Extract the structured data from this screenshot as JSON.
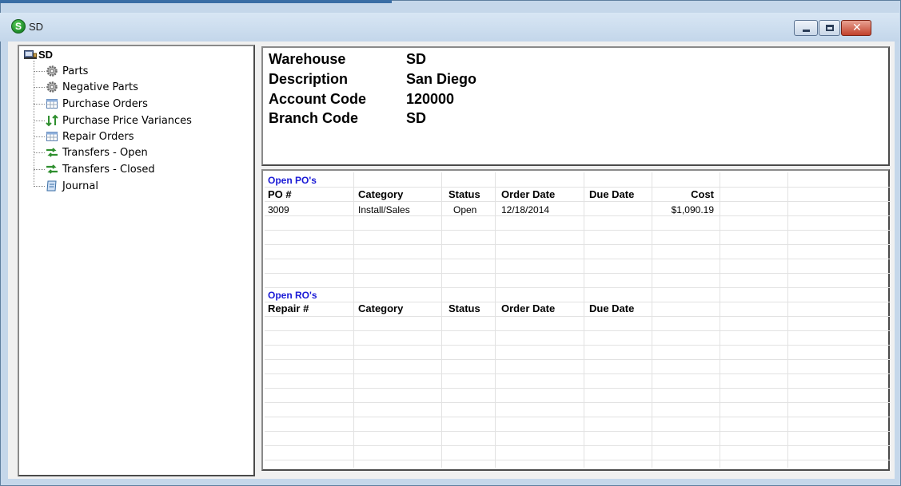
{
  "window": {
    "title": "SD",
    "app_icon_letter": "S"
  },
  "tree": {
    "root_label": "SD",
    "items": [
      {
        "label": "Parts",
        "icon": "gear-icon"
      },
      {
        "label": "Negative Parts",
        "icon": "gear-icon"
      },
      {
        "label": "Purchase Orders",
        "icon": "table-icon"
      },
      {
        "label": "Purchase Price Variances",
        "icon": "up-down-arrows-icon"
      },
      {
        "label": "Repair Orders",
        "icon": "table-icon"
      },
      {
        "label": "Transfers - Open",
        "icon": "transfer-icon"
      },
      {
        "label": "Transfers - Closed",
        "icon": "transfer-icon"
      },
      {
        "label": "Journal",
        "icon": "journal-icon"
      }
    ]
  },
  "info": {
    "warehouse_label": "Warehouse",
    "warehouse_value": "SD",
    "description_label": "Description",
    "description_value": "San Diego",
    "account_code_label": "Account Code",
    "account_code_value": "120000",
    "branch_code_label": "Branch Code",
    "branch_code_value": "SD"
  },
  "open_pos": {
    "section_title": "Open PO's",
    "headers": [
      "PO #",
      "Category",
      "Status",
      "Order Date",
      "Due Date",
      "Cost"
    ],
    "rows": [
      [
        "3009",
        "Install/Sales",
        "Open",
        "12/18/2014",
        "",
        "$1,090.19"
      ]
    ]
  },
  "open_ros": {
    "section_title": "Open RO's",
    "headers": [
      "Repair #",
      "Category",
      "Status",
      "Order Date",
      "Due Date"
    ],
    "rows": []
  },
  "colors": {
    "section_title": "#1a1ad6",
    "window_frame": "#c5d7ea",
    "close_button": "#c2412b"
  }
}
